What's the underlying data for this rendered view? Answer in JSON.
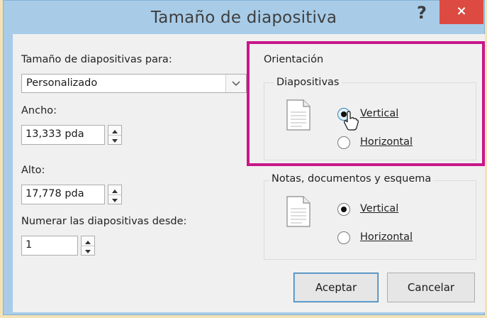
{
  "window": {
    "title": "Tamaño de diapositiva",
    "help_label": "?",
    "close_label": "×"
  },
  "left": {
    "size_for_label": "Tamaño de diapositivas para:",
    "size_for_value": "Personalizado",
    "width_label": "Ancho:",
    "width_value": "13,333 pda",
    "height_label": "Alto:",
    "height_value": "17,778 pda",
    "number_from_label": "Numerar las diapositivas desde:",
    "number_from_value": "1"
  },
  "orientation": {
    "title": "Orientación",
    "slides": {
      "title": "Diapositivas",
      "vertical_label": "Vertical",
      "horizontal_label": "Horizontal",
      "selected": "Vertical"
    },
    "notes": {
      "title": "Notas, documentos y esquema",
      "vertical_label": "Vertical",
      "horizontal_label": "Horizontal",
      "selected": "Vertical"
    }
  },
  "buttons": {
    "ok": "Aceptar",
    "cancel": "Cancelar"
  },
  "colors": {
    "accent_highlight": "#c8178a",
    "close_red": "#dc4a42",
    "frame_blue": "#a8cce8"
  }
}
